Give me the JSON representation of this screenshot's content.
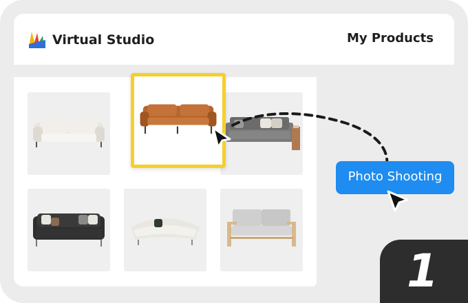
{
  "app": {
    "name": "Virtual Studio"
  },
  "nav": {
    "my_products": "My Products"
  },
  "products": [
    {
      "name": "White sofa",
      "icon": "sofa-white"
    },
    {
      "name": "Brown leather sofa",
      "icon": "sofa-brown",
      "selected": true
    },
    {
      "name": "Grey sofa with pillows",
      "icon": "sofa-grey"
    },
    {
      "name": "Black sofa with pillows",
      "icon": "sofa-black"
    },
    {
      "name": "Cream curved sofa",
      "icon": "sofa-cream"
    },
    {
      "name": "Grey sofa with wood frame",
      "icon": "sofa-wood"
    }
  ],
  "action": {
    "label": "Photo Shooting"
  },
  "step": {
    "number": "1"
  },
  "colors": {
    "accent": "#1e8cf0",
    "selection": "#f5cf2b",
    "badge": "#2d2d2d",
    "background": "#ececec"
  }
}
